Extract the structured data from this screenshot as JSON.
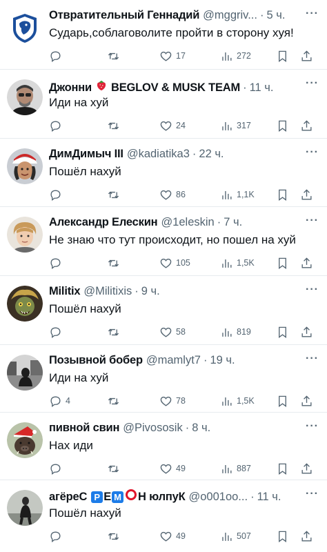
{
  "tweets": [
    {
      "name": "Отвратительный Геннадий",
      "handle": "@mggriv...",
      "time": "5 ч.",
      "text": "Сударь,соблаговолите пройти в сторону хуя!",
      "replies": "",
      "retweets": "",
      "likes": "17",
      "views": "272"
    },
    {
      "name": "Джонни",
      "name_suffix": "BEGLOV & MUSK TEAM",
      "handle": "",
      "time": "11 ч.",
      "text": "Иди на хуй",
      "replies": "",
      "retweets": "",
      "likes": "24",
      "views": "317"
    },
    {
      "name": "ДимДимыч III",
      "handle": "@kadiatika3",
      "time": "22 ч.",
      "text": "Пошёл нахуй",
      "replies": "",
      "retweets": "",
      "likes": "86",
      "views": "1,1K"
    },
    {
      "name": "Александр Елескин",
      "handle": "@1eleskin",
      "time": "7 ч.",
      "text": "Не знаю что тут происходит, но пошел на хуй",
      "replies": "",
      "retweets": "",
      "likes": "105",
      "views": "1,5K"
    },
    {
      "name": "Militix",
      "handle": "@Militixis",
      "time": "9 ч.",
      "text": "Пошёл нахуй",
      "replies": "",
      "retweets": "",
      "likes": "58",
      "views": "819"
    },
    {
      "name": "Позывной бобер",
      "handle": "@mamlyt7",
      "time": "19 ч.",
      "text": "Иди на хуй",
      "replies": "4",
      "retweets": "",
      "likes": "78",
      "views": "1,5K"
    },
    {
      "name": "пивной свин",
      "handle": "@Pivososik",
      "time": "8 ч.",
      "text": "Нах иди",
      "replies": "",
      "retweets": "",
      "likes": "49",
      "views": "887"
    },
    {
      "name_prefix": "агёреС",
      "name_letters": [
        "P",
        "E",
        "M"
      ],
      "name_after": "Н юлпуК",
      "handle": "@o001oo...",
      "time": "11 ч.",
      "text": "Пошёл нахуй",
      "replies": "",
      "retweets": "",
      "likes": "49",
      "views": "507"
    }
  ],
  "ui": {
    "separator": "·",
    "more": "···",
    "colors": {
      "text": "#0f1419",
      "muted": "#536471",
      "divider": "#e6ebee",
      "blue_square": "#1d7ce8",
      "red_circle": "#e0142a"
    },
    "icons": [
      "reply-icon",
      "retweet-icon",
      "like-icon",
      "views-icon",
      "bookmark-icon",
      "share-icon",
      "more-icon"
    ]
  }
}
